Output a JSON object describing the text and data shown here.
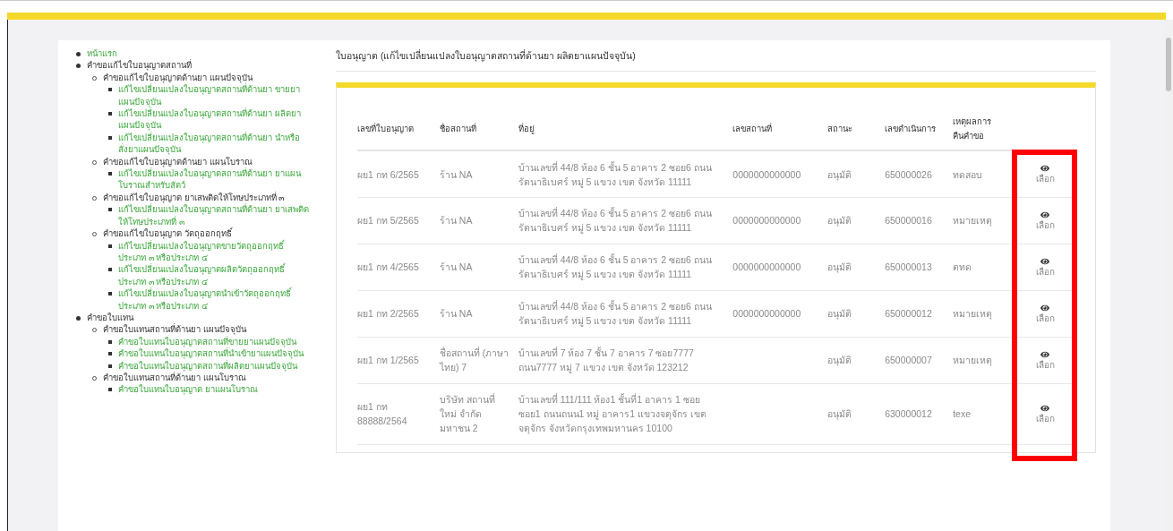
{
  "sidebar": {
    "items": [
      {
        "label": "หน้าแรก",
        "link": true
      },
      {
        "label": "คำขอแก้ไขใบอนุญาตสถานที่",
        "link": false,
        "children": [
          {
            "label": "คำขอแก้ไขใบอนุญาตด้านยา แผนปัจจุบัน",
            "link": false,
            "children": [
              {
                "label": "แก้ไขเปลี่ยนแปลงใบอนุญาตสถานที่ด้านยา ขายยาแผนปัจจุบัน",
                "link": true
              },
              {
                "label": "แก้ไขเปลี่ยนแปลงใบอนุญาตสถานที่ด้านยา ผลิตยาแผนปัจจุบัน",
                "link": true
              },
              {
                "label": "แก้ไขเปลี่ยนแปลงใบอนุญาตสถานที่ด้านยา นำหรือสั่งยาแผนปัจจุบัน",
                "link": true
              }
            ]
          },
          {
            "label": "คำขอแก้ไขใบอนุญาตด้านยา แผนโบราณ",
            "link": false,
            "children": [
              {
                "label": "แก้ไขเปลี่ยนแปลงใบอนุญาตสถานที่ด้านยา ยาแผนโบราณสำหรับสัตว์",
                "link": true
              }
            ]
          },
          {
            "label": "คำขอแก้ไขใบอนุญาต ยาเสพติดให้โทษประเภทที่ ๓",
            "link": false,
            "children": [
              {
                "label": "แก้ไขเปลี่ยนแปลงใบอนุญาตสถานที่ด้านยา ยาเสพติดให้โทษประเภทที่ ๓",
                "link": true
              }
            ]
          },
          {
            "label": "คำขอแก้ไขใบอนุญาต วัตถุออกฤทธิ์",
            "link": false,
            "children": [
              {
                "label": "แก้ไขเปลี่ยนแปลงใบอนุญาตขายวัตถุออกฤทธิ์ ประเภท ๓ หรือประเภท ๔",
                "link": true
              },
              {
                "label": "แก้ไขเปลี่ยนแปลงใบอนุญาตผลิตวัตถุออกฤทธิ์ ประเภท ๓ หรือประเภท ๔",
                "link": true
              },
              {
                "label": "แก้ไขเปลี่ยนแปลงใบอนุญาตนำเข้าวัตถุออกฤทธิ์ ประเภท ๓ หรือประเภท ๔",
                "link": true
              }
            ]
          }
        ]
      },
      {
        "label": "คำขอใบแทน",
        "link": false,
        "children": [
          {
            "label": "คำขอใบแทนสถานที่ด้านยา แผนปัจจุบัน",
            "link": false,
            "children": [
              {
                "label": "คำขอใบแทนใบอนุญาตสถานที่ขายยาแผนปัจจุบัน",
                "link": true
              },
              {
                "label": "คำขอใบแทนใบอนุญาตสถานที่นำเข้ายาแผนปัจจุบัน",
                "link": true
              },
              {
                "label": "คำขอใบแทนใบอนุญาตสถานที่ผลิตยาแผนปัจจุบัน",
                "link": true
              }
            ]
          },
          {
            "label": "คำขอใบแทนสถานที่ด้านยา แผนโบราณ",
            "link": false,
            "children": [
              {
                "label": "คำขอใบแทนใบอนุญาต ยาแผนโบราณ",
                "link": true
              }
            ]
          }
        ]
      }
    ]
  },
  "page_title": "ใบอนุญาต (แก้ไขเปลี่ยนแปลงใบอนุญาตสถานที่ด้านยา ผลิตยาแผนปัจจุบัน)",
  "table": {
    "columns": [
      "เลขที่ใบอนุญาต",
      "ชื่อสถานที่",
      "ที่อยู่",
      "เลขสถานที่",
      "สถานะ",
      "เลขดำเนินการ",
      "เหตุผลการคืนคำขอ"
    ],
    "rows": [
      {
        "license": "ผย1 กท 6/2565",
        "name": "ร้าน NA",
        "address": "บ้านเลขที่ 44/8 ห้อง 6 ชั้น 5 อาคาร 2 ซอย6 ถนน รัตนาธิเบศร์ หมู่ 5 แขวง เขต จังหวัด 11111",
        "place_no": "0000000000000",
        "status": "อนุมัติ",
        "op_no": "650000026",
        "reason": "ทดสอบ",
        "action": "เลือก"
      },
      {
        "license": "ผย1 กท 5/2565",
        "name": "ร้าน NA",
        "address": "บ้านเลขที่ 44/8 ห้อง 6 ชั้น 5 อาคาร 2 ซอย6 ถนน รัตนาธิเบศร์ หมู่ 5 แขวง เขต จังหวัด 11111",
        "place_no": "0000000000000",
        "status": "อนุมัติ",
        "op_no": "650000016",
        "reason": "หมายเหตุ",
        "action": "เลือก"
      },
      {
        "license": "ผย1 กท 4/2565",
        "name": "ร้าน NA",
        "address": "บ้านเลขที่ 44/8 ห้อง 6 ชั้น 5 อาคาร 2 ซอย6 ถนน รัตนาธิเบศร์ หมู่ 5 แขวง เขต จังหวัด 11111",
        "place_no": "0000000000000",
        "status": "อนุมัติ",
        "op_no": "650000013",
        "reason": "ตทด",
        "action": "เลือก"
      },
      {
        "license": "ผย1 กท 2/2565",
        "name": "ร้าน NA",
        "address": "บ้านเลขที่ 44/8 ห้อง 6 ชั้น 5 อาคาร 2 ซอย6 ถนน รัตนาธิเบศร์ หมู่ 5 แขวง เขต จังหวัด 11111",
        "place_no": "0000000000000",
        "status": "อนุมัติ",
        "op_no": "650000012",
        "reason": "หมายเหตุ",
        "action": "เลือก"
      },
      {
        "license": "ผย1 กท 1/2565",
        "name": "ชื่อสถานที่ (ภาษาไทย) 7",
        "address": "บ้านเลขที่ 7 ห้อง 7 ชั้น 7 อาคาร 7 ซอย7777 ถนน7777 หมู่ 7 แขวง เขต จังหวัด 123212",
        "status": "อนุมัติ",
        "op_no": "650000007",
        "reason": "หมายเหตุ",
        "action": "เลือก"
      },
      {
        "license": "ผย1 กท 88888/2564",
        "name": "บริษัท สถานที่ใหม่ จำกัด มหาชน 2",
        "address": "บ้านเลขที่ 111/111 ห้อง1 ชั้นที่1 อาคาร 1 ซอย ซอย1 ถนนถนน1 หมู่ อาคาร1 แขวงจตุจักร เขต จตุจักร จังหวัดกรุงเทพมหานคร 10100",
        "status": "อนุมัติ",
        "op_no": "630000012",
        "reason": "texe",
        "action": "เลือก"
      }
    ]
  }
}
